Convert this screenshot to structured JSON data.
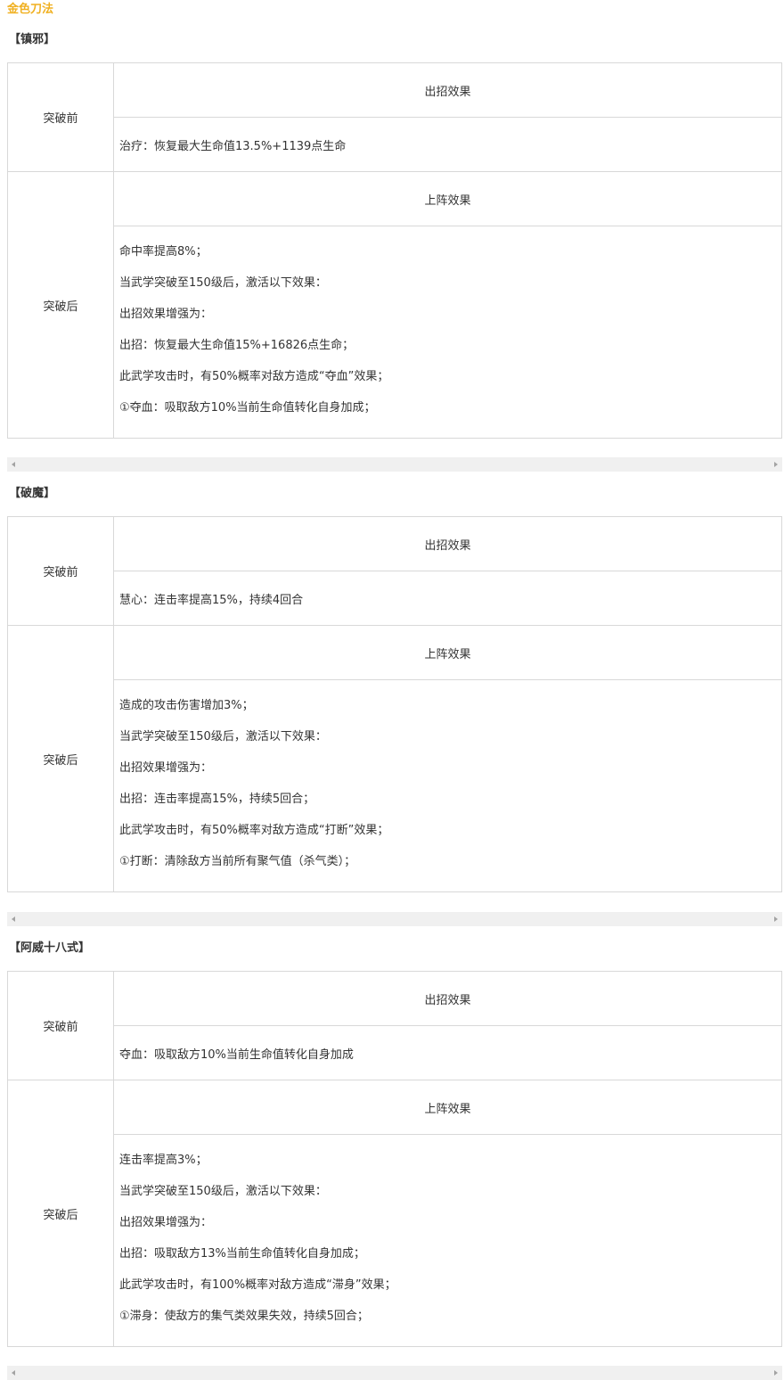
{
  "page_title": "金色刀法",
  "sections": [
    {
      "title": "【镇邪】",
      "before_label": "突破前",
      "before_header": "出招效果",
      "before_text": "治疗：恢复最大生命值13.5%+1139点生命",
      "after_label": "突破后",
      "after_header": "上阵效果",
      "after_lines": [
        "命中率提高8%；",
        "当武学突破至150级后，激活以下效果：",
        "出招效果增强为：",
        "出招：恢复最大生命值15%+16826点生命；",
        "此武学攻击时，有50%概率对敌方造成“夺血”效果；",
        "①夺血：吸取敌方10%当前生命值转化自身加成；"
      ]
    },
    {
      "title": "【破魔】",
      "before_label": "突破前",
      "before_header": "出招效果",
      "before_text": "慧心：连击率提高15%，持续4回合",
      "after_label": "突破后",
      "after_header": "上阵效果",
      "after_lines": [
        "造成的攻击伤害增加3%；",
        "当武学突破至150级后，激活以下效果：",
        "出招效果增强为：",
        "出招：连击率提高15%，持续5回合；",
        "此武学攻击时，有50%概率对敌方造成“打断”效果；",
        "①打断：清除敌方当前所有聚气值（杀气类）；"
      ]
    },
    {
      "title": "【阿威十八式】",
      "before_label": "突破前",
      "before_header": "出招效果",
      "before_text": "夺血：吸取敌方10%当前生命值转化自身加成",
      "after_label": "突破后",
      "after_header": "上阵效果",
      "after_lines": [
        "连击率提高3%；",
        "当武学突破至150级后，激活以下效果：",
        "出招效果增强为：",
        "出招：吸取敌方13%当前生命值转化自身加成；",
        "此武学攻击时，有100%概率对敌方造成“滞身”效果；",
        "①滞身：使敌方的集气类效果失效，持续5回合；"
      ]
    }
  ],
  "colors": {
    "title_accent": "#f0b020",
    "border": "#d8d8d8",
    "text": "#333333",
    "scrollbar_track": "#f0f0f0",
    "scrollbar_arrow": "#a3a3a3"
  },
  "icons": [
    "scroll-left-arrow-icon",
    "scroll-right-arrow-icon"
  ]
}
